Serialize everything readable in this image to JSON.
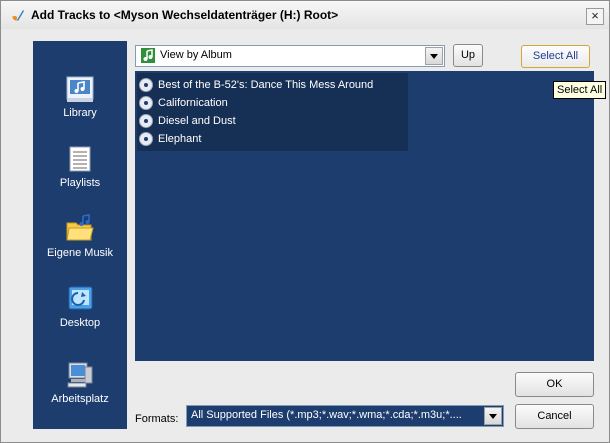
{
  "window": {
    "title": "Add Tracks to <Myson Wechseldatenträger (H:) Root>",
    "close_label": "×"
  },
  "places": [
    {
      "label": "Library",
      "icon": "library-icon"
    },
    {
      "label": "Playlists",
      "icon": "playlists-icon"
    },
    {
      "label": "Eigene Musik",
      "icon": "music-folder-icon"
    },
    {
      "label": "Desktop",
      "icon": "desktop-icon"
    },
    {
      "label": "Arbeitsplatz",
      "icon": "computer-icon"
    }
  ],
  "view": {
    "selected": "View by Album",
    "icon": "music-note-icon"
  },
  "buttons": {
    "up": "Up",
    "select_all": "Select All",
    "ok": "OK",
    "cancel": "Cancel"
  },
  "tooltip": "Select All",
  "items": [
    {
      "label": "Best of the B-52's: Dance This Mess Around",
      "icon": "cd-icon"
    },
    {
      "label": "Californication",
      "icon": "cd-icon"
    },
    {
      "label": "Diesel and Dust",
      "icon": "cd-icon"
    },
    {
      "label": "Elephant",
      "icon": "cd-icon"
    }
  ],
  "formats": {
    "label": "Formats:",
    "selected": "All Supported Files (*.mp3;*.wav;*.wma;*.cda;*.m3u;*...."
  },
  "colors": {
    "panel_bg": "#1d3d6f",
    "selection_bg": "#163055",
    "dialog_bg": "#ebebeb"
  }
}
